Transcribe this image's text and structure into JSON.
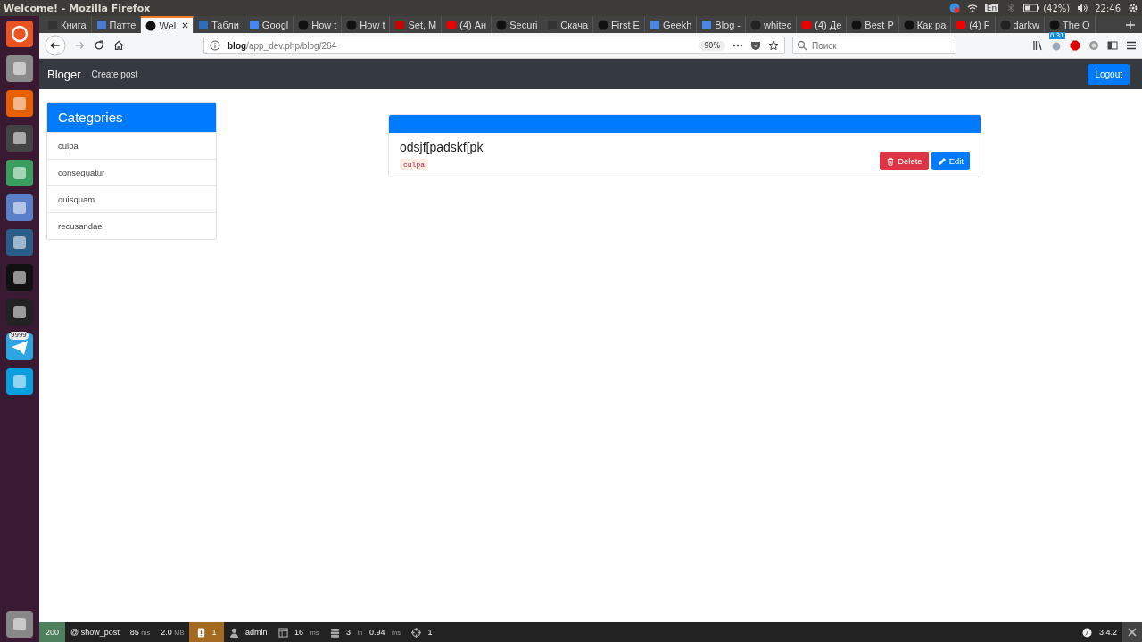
{
  "window": {
    "title": "Welcome! - Mozilla Firefox"
  },
  "tray": {
    "keyboard": "En",
    "battery": "(42%)",
    "clock": "22:46"
  },
  "tabs": [
    {
      "label": "Книга",
      "kind": "dark",
      "selected": false
    },
    {
      "label": "Патте",
      "kind": "chart",
      "selected": false
    },
    {
      "label": "Wel",
      "kind": "symfony",
      "selected": true
    },
    {
      "label": "Табли",
      "kind": "table",
      "selected": false
    },
    {
      "label": "Googl",
      "kind": "google",
      "selected": false
    },
    {
      "label": "How t",
      "kind": "symfony",
      "selected": false
    },
    {
      "label": "How t",
      "kind": "symfony",
      "selected": false
    },
    {
      "label": "Set, M",
      "kind": "red",
      "selected": false
    },
    {
      "label": "(4) Ан",
      "kind": "youtube",
      "selected": false
    },
    {
      "label": "Securi",
      "kind": "symfony",
      "selected": false
    },
    {
      "label": "Скача",
      "kind": "dark",
      "selected": false
    },
    {
      "label": "First E",
      "kind": "symfony",
      "selected": false
    },
    {
      "label": "Geekh",
      "kind": "docs",
      "selected": false
    },
    {
      "label": "Blog -",
      "kind": "docs",
      "selected": false
    },
    {
      "label": "whitec",
      "kind": "github",
      "selected": false
    },
    {
      "label": "(4) Де",
      "kind": "youtube",
      "selected": false
    },
    {
      "label": "Best P",
      "kind": "symfony",
      "selected": false
    },
    {
      "label": "Как ра",
      "kind": "symfony",
      "selected": false
    },
    {
      "label": "(4) F",
      "kind": "youtube",
      "selected": false
    },
    {
      "label": "darkw",
      "kind": "github",
      "selected": false
    },
    {
      "label": "The O",
      "kind": "symfony",
      "selected": false
    }
  ],
  "dock_badge": "9999",
  "address_bar": {
    "url": "**blog**/app_dev.php/blog/264",
    "zoom": "90%"
  },
  "search": {
    "placeholder": "Поиск"
  },
  "toolbar_badge": "0.31",
  "navbar": {
    "brand": "Bloger",
    "links": [
      "Create post"
    ],
    "logout": "Logout"
  },
  "categories": {
    "title": "Categories",
    "items": [
      "culpa",
      "consequatur",
      "quisquam",
      "recusandae"
    ]
  },
  "post": {
    "title": "odsjf[padskf[pk",
    "tag": "culpa",
    "buttons": [
      {
        "label": "Delete",
        "kind": "delete"
      },
      {
        "label": "Edit",
        "kind": "edit"
      }
    ]
  },
  "debug_bar": {
    "status": "200",
    "route": "@ show_post",
    "time": "85",
    "time_unit": "ms",
    "memory": "2.0",
    "memory_unit": "MB",
    "warnings": "1",
    "user": "admin",
    "render": "16",
    "render_unit": "ms",
    "queries": "3",
    "queries_in": "in",
    "queries_time": "0.94",
    "queries_unit": "ms",
    "forms": "1",
    "version": "3.4.2"
  }
}
